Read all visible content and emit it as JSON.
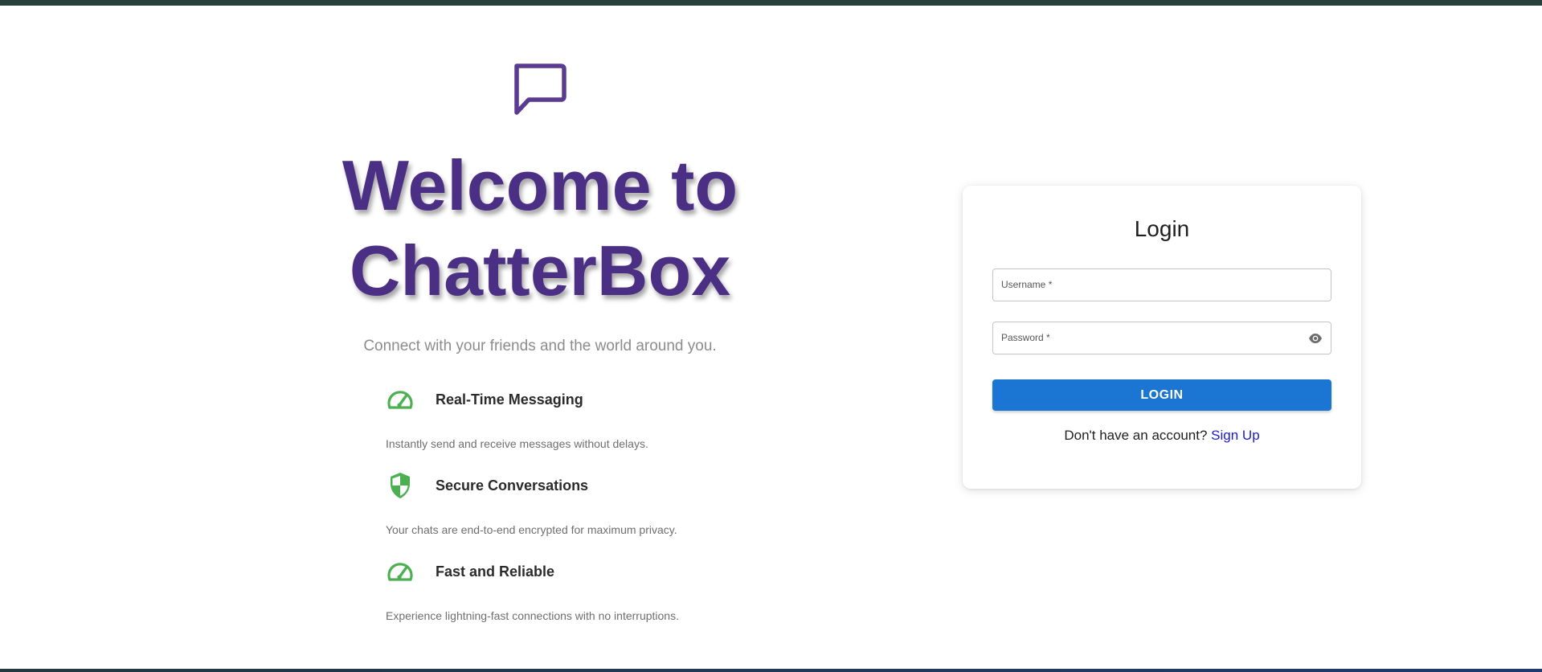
{
  "hero": {
    "icon": "chat-bubble-icon",
    "title_line1": "Welcome to",
    "title_line2": "ChatterBox",
    "subtitle": "Connect with your friends and the world around you.",
    "accent_color": "#4a2f84"
  },
  "features": [
    {
      "icon": "speedometer-icon",
      "title": "Real-Time Messaging",
      "description": "Instantly send and receive messages without delays."
    },
    {
      "icon": "shield-icon",
      "title": "Secure Conversations",
      "description": "Your chats are end-to-end encrypted for maximum privacy."
    },
    {
      "icon": "speedometer-icon",
      "title": "Fast and Reliable",
      "description": "Experience lightning-fast connections with no interruptions."
    }
  ],
  "feature_icon_color": "#4caf50",
  "login": {
    "title": "Login",
    "username_label": "Username *",
    "username_value": "",
    "password_label": "Password *",
    "password_value": "",
    "password_toggle_icon": "eye-icon",
    "button_label": "LOGIN",
    "button_color": "#1a76d2",
    "signup_prompt": "Don't have an account?",
    "signup_link": "Sign Up"
  }
}
